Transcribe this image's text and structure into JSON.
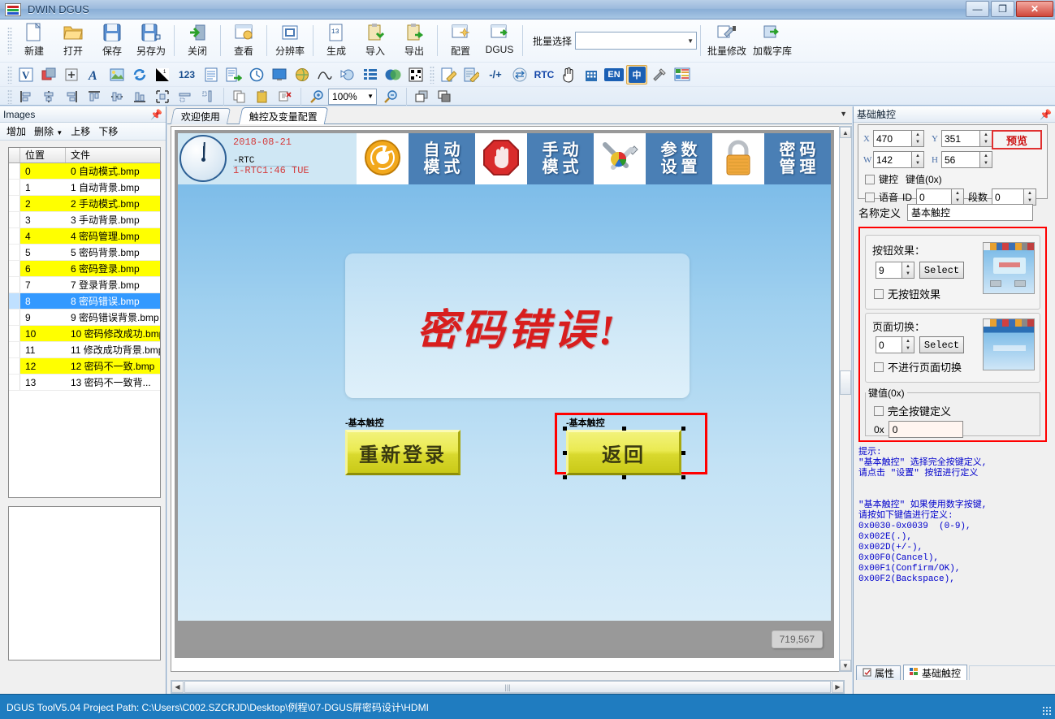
{
  "window": {
    "title": "DWIN DGUS",
    "minimize": "—",
    "maximize": "❐",
    "close": "✕"
  },
  "toolbar": {
    "row1": [
      {
        "label": "新建",
        "icon": "new-file-icon",
        "glyph": "📄"
      },
      {
        "label": "打开",
        "icon": "open-folder-icon",
        "glyph": "📂"
      },
      {
        "label": "保存",
        "icon": "save-icon",
        "glyph": "💾"
      },
      {
        "label": "另存为",
        "icon": "save-as-icon",
        "glyph": "💾"
      },
      {
        "label": "关闭",
        "icon": "close-project-icon",
        "glyph": "⏩"
      },
      {
        "label": "查看",
        "icon": "view-icon",
        "glyph": "🗔"
      },
      {
        "label": "分辨率",
        "icon": "resolution-icon",
        "glyph": "⬚"
      },
      {
        "label": "生成",
        "icon": "generate-icon",
        "glyph": "🗎"
      },
      {
        "label": "导入",
        "icon": "import-icon",
        "glyph": "📋"
      },
      {
        "label": "导出",
        "icon": "export-icon",
        "glyph": "📋"
      },
      {
        "label": "配置",
        "icon": "config-icon",
        "glyph": "🗖"
      },
      {
        "label": "DGUS",
        "icon": "dgus-icon",
        "glyph": "🗖"
      }
    ],
    "batch_select_label": "批量选择",
    "batch_select_value": "",
    "batch_modify_label": "批量修改",
    "load_font_label": "加载字库",
    "row2_icons": [
      "variable-icon",
      "picture-overlay-icon",
      "crosshair-icon",
      "text-icon",
      "image-icon",
      "animation-icon",
      "gradient-icon",
      "number-icon",
      "textbox-icon",
      "data-import-icon",
      "clock-icon",
      "display-icon",
      "globe-icon",
      "curve-icon",
      "slider-icon",
      "list-icon",
      "gauge-icon",
      "qrcode-icon"
    ],
    "row2b_icons": [
      "edit-icon",
      "note-edit-icon",
      "plusminus-icon",
      "swap-icon",
      "rtc-icon",
      "hand-cursor-icon",
      "keypad-icon",
      "en-icon",
      "cn-icon",
      "tools-icon",
      "layout-icon"
    ],
    "row2b_labels": {
      "rtc": "RTC",
      "en": "EN",
      "cn": "中"
    },
    "row3_icons": [
      "align-left-icon",
      "align-center-h-icon",
      "align-right-icon",
      "align-top-icon",
      "align-middle-icon",
      "align-bottom-icon",
      "fit-selection-icon",
      "distribute-h-icon",
      "distribute-v-icon",
      "copy-icon",
      "paste-icon",
      "delete-icon",
      "zoom-in-icon",
      "zoom-out-icon",
      "bring-front-icon",
      "send-back-icon"
    ],
    "zoom_value": "100%"
  },
  "images_panel": {
    "title": "Images",
    "pin_icon": "pin-icon",
    "tools": [
      "增加",
      "删除",
      "上移",
      "下移"
    ],
    "columns": [
      "位置",
      "文件"
    ],
    "rows": [
      {
        "pos": "0",
        "file": "0 自动模式.bmp",
        "state": "yellow"
      },
      {
        "pos": "1",
        "file": "1 自动背景.bmp",
        "state": "normal"
      },
      {
        "pos": "2",
        "file": "2 手动模式.bmp",
        "state": "yellow"
      },
      {
        "pos": "3",
        "file": "3 手动背景.bmp",
        "state": "normal"
      },
      {
        "pos": "4",
        "file": "4 密码管理.bmp",
        "state": "yellow"
      },
      {
        "pos": "5",
        "file": "5 密码背景.bmp",
        "state": "normal"
      },
      {
        "pos": "6",
        "file": "6 密码登录.bmp",
        "state": "yellow"
      },
      {
        "pos": "7",
        "file": "7 登录背景.bmp",
        "state": "normal"
      },
      {
        "pos": "8",
        "file": "8 密码错误.bmp",
        "state": "selected"
      },
      {
        "pos": "9",
        "file": "9 密码错误背景.bmp",
        "state": "normal"
      },
      {
        "pos": "10",
        "file": "10 密码修改成功.bmp",
        "state": "yellow"
      },
      {
        "pos": "11",
        "file": "11 修改成功背景.bmp",
        "state": "normal"
      },
      {
        "pos": "12",
        "file": "12 密码不一致.bmp",
        "state": "yellow"
      },
      {
        "pos": "13",
        "file": "13 密码不一致背...",
        "state": "normal"
      }
    ]
  },
  "center": {
    "tabs": [
      {
        "label": "欢迎使用",
        "active": false
      },
      {
        "label": "触控及变量配置",
        "active": true
      }
    ],
    "canvas": {
      "rtc": {
        "date": "2018-08-21",
        "label": "-RTC",
        "time": "1-RTC1:46 TUE",
        "clock_icon": "analog-clock-icon"
      },
      "nav_items": [
        {
          "type": "icon",
          "icon": "refresh-circle-icon",
          "label": ""
        },
        {
          "type": "text",
          "label": "自动\n模式"
        },
        {
          "type": "icon",
          "icon": "stop-hand-icon",
          "label": ""
        },
        {
          "type": "text",
          "label": "手动\n模式"
        },
        {
          "type": "icon",
          "icon": "tools-wrench-icon",
          "label": ""
        },
        {
          "type": "text",
          "label": "参数\n设置"
        },
        {
          "type": "icon",
          "icon": "lock-icon",
          "label": ""
        },
        {
          "type": "text",
          "label": "密码\n管理"
        }
      ],
      "message": "密码错误!",
      "buttons": [
        {
          "tag": "-基本触控",
          "label": "重新登录",
          "selected": false
        },
        {
          "tag": "-基本触控",
          "label": "返回",
          "selected": true
        }
      ],
      "coordinate": "719,567"
    }
  },
  "properties": {
    "title": "基础触控",
    "pin_icon": "pin-icon",
    "fields": {
      "x_label": "X",
      "x_value": "470",
      "y_label": "Y",
      "y_value": "351",
      "w_label": "W",
      "w_value": "142",
      "h_label": "H",
      "h_value": "56"
    },
    "preview_button": "预览",
    "keycontrol_label": "键控",
    "keyvalue_label": "键值(0x)",
    "voice_label": "语音",
    "voice_id_label": "ID",
    "voice_id_value": "0",
    "segment_label": "段数",
    "segment_value": "0",
    "name_def_label": "名称定义",
    "name_def_value": "基本触控",
    "button_effect": {
      "label": "按钮效果：",
      "value": "9",
      "select_button": "Select",
      "no_effect_label": "无按钮效果"
    },
    "page_switch": {
      "label": "页面切换：",
      "value": "0",
      "select_button": "Select",
      "no_switch_label": "不进行页面切换"
    },
    "key_value_group": {
      "legend": "键值(0x)",
      "full_key_def_label": "完全按键定义",
      "prefix": "0x",
      "value": "0"
    },
    "hint_text": "提示:\n\"基本触控\" 选择完全按键定义,\n请点击 \"设置\" 按钮进行定义\n\n\n\"基本触控\" 如果使用数字按键,\n请按如下键值进行定义:\n0x0030-0x0039  (0-9),\n0x002E(.),\n0x002D(+/-),\n0x00F0(Cancel),\n0x00F1(Confirm/OK),\n0x00F2(Backspace),",
    "bottom_tabs": [
      {
        "label": "属性",
        "icon": "properties-icon",
        "active": false
      },
      {
        "label": "基础触控",
        "icon": "touch-icon",
        "active": true
      }
    ]
  },
  "statusbar": {
    "text": "DGUS ToolV5.04  Project Path: C:\\Users\\C002.SZCRJD\\Desktop\\例程\\07-DGUS屏密码设计\\HDMI"
  },
  "colors": {
    "accent": "#1f7cc0",
    "selection_red": "#ff0000",
    "highlight_yellow": "#ffff00",
    "row_selected_blue": "#3399ff",
    "hint_blue": "#0000cc"
  }
}
